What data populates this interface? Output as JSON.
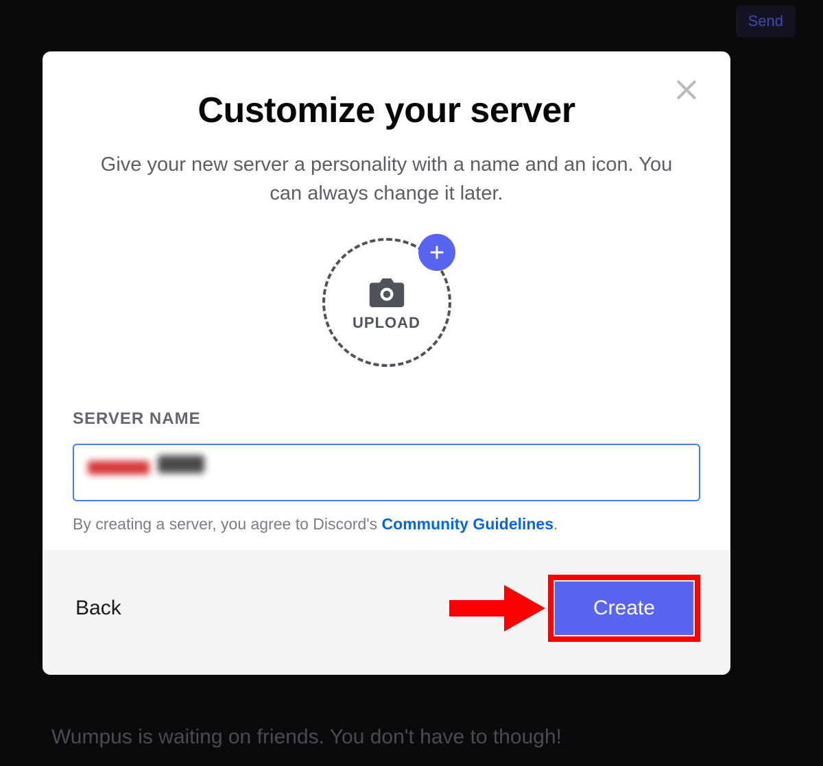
{
  "background": {
    "send_button_label": "Send",
    "wumpus_text": "Wumpus is waiting on friends. You don't have to though!"
  },
  "modal": {
    "title": "Customize your server",
    "subtitle": "Give your new server a personality with a name and an icon. You can always change it later.",
    "upload_label": "UPLOAD",
    "form": {
      "server_name_label": "SERVER NAME",
      "server_name_value": ""
    },
    "terms": {
      "prefix": "By creating a server, you agree to Discord's ",
      "link_text": "Community Guidelines",
      "suffix": "."
    },
    "footer": {
      "back_label": "Back",
      "create_label": "Create"
    }
  },
  "annotation": {
    "arrow_color": "#ff0000",
    "highlight_color": "#ff0000"
  }
}
